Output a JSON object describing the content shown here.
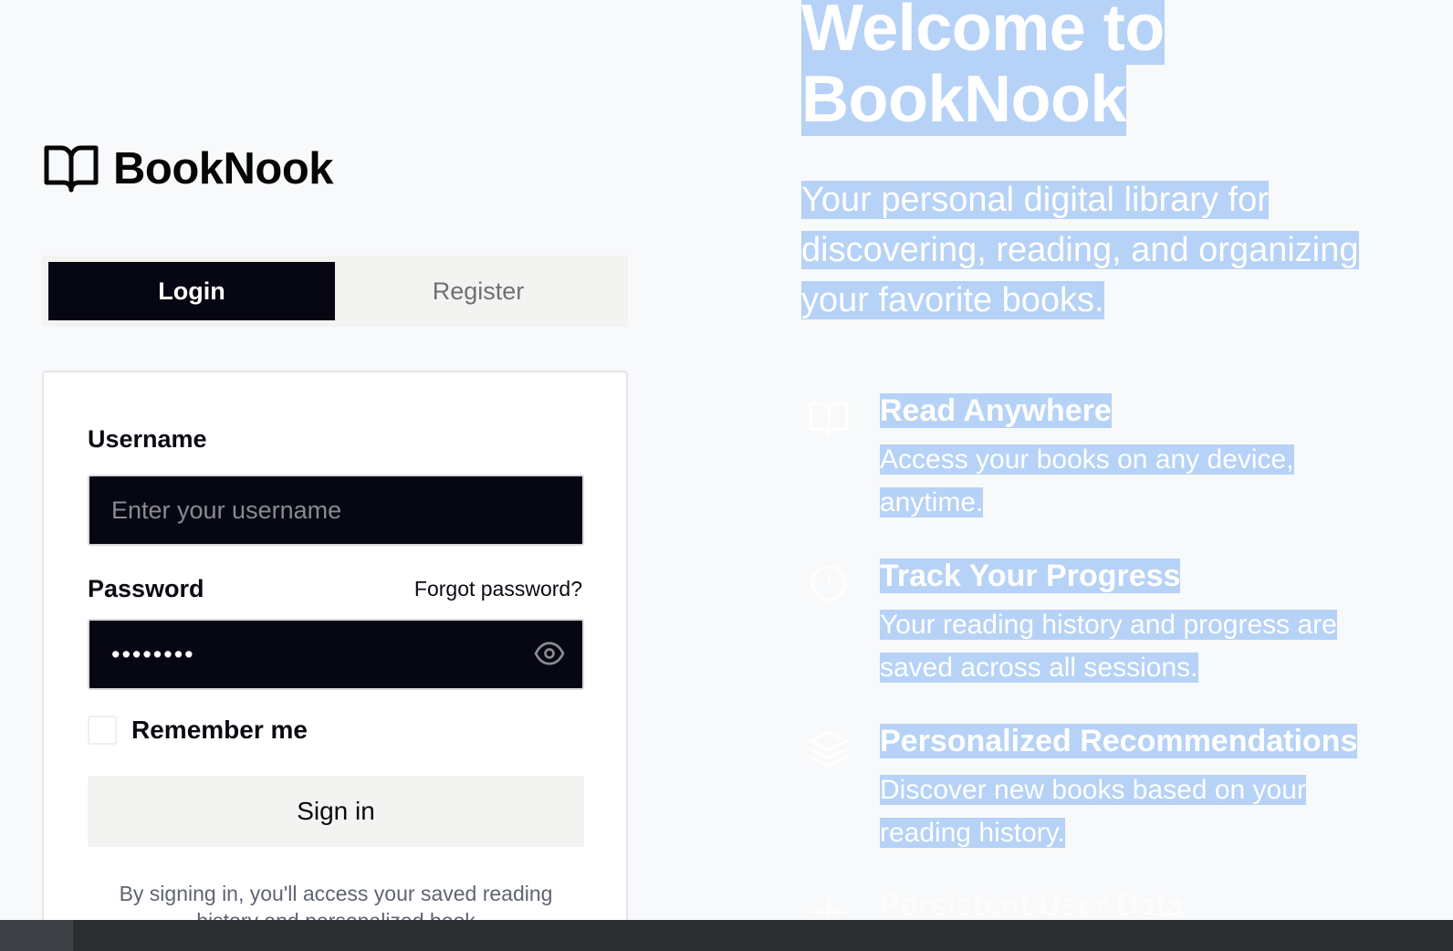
{
  "brand": {
    "name": "BookNook",
    "icon": "open-book-icon"
  },
  "auth_tabs": {
    "login_label": "Login",
    "register_label": "Register",
    "active": "Login"
  },
  "login_form": {
    "username_label": "Username",
    "username_placeholder": "Enter your username",
    "password_label": "Password",
    "forgot_password": "Forgot password?",
    "password_value": "••••••••",
    "show_password_icon": "eye-icon",
    "remember_me": "Remember me",
    "remember_checked": false,
    "signin_label": "Sign in",
    "disclaimer": "By signing in, you'll access your saved reading history and personalized book"
  },
  "hero": {
    "title_line1": "Welcome to",
    "title_line2": "BookNook",
    "tagline": "Your personal digital library for discovering, reading, and organizing your favorite books.",
    "features": [
      {
        "icon": "book-open-icon",
        "title": "Read Anywhere",
        "description": "Access your books on any device, anytime."
      },
      {
        "icon": "clock-icon",
        "title": "Track Your Progress",
        "description": "Your reading history and progress are saved across all sessions."
      },
      {
        "icon": "layers-icon",
        "title": "Personalized Recommendations",
        "description": "Discover new books based on your reading history."
      },
      {
        "icon": "plus-icon",
        "title": "Persistent User Data",
        "description": ""
      }
    ]
  },
  "colors": {
    "page_background": "#f8f9fb",
    "dark_fill": "#060712",
    "text_selection": "#b6d2f6",
    "muted_tab": "#f3f3f1"
  }
}
